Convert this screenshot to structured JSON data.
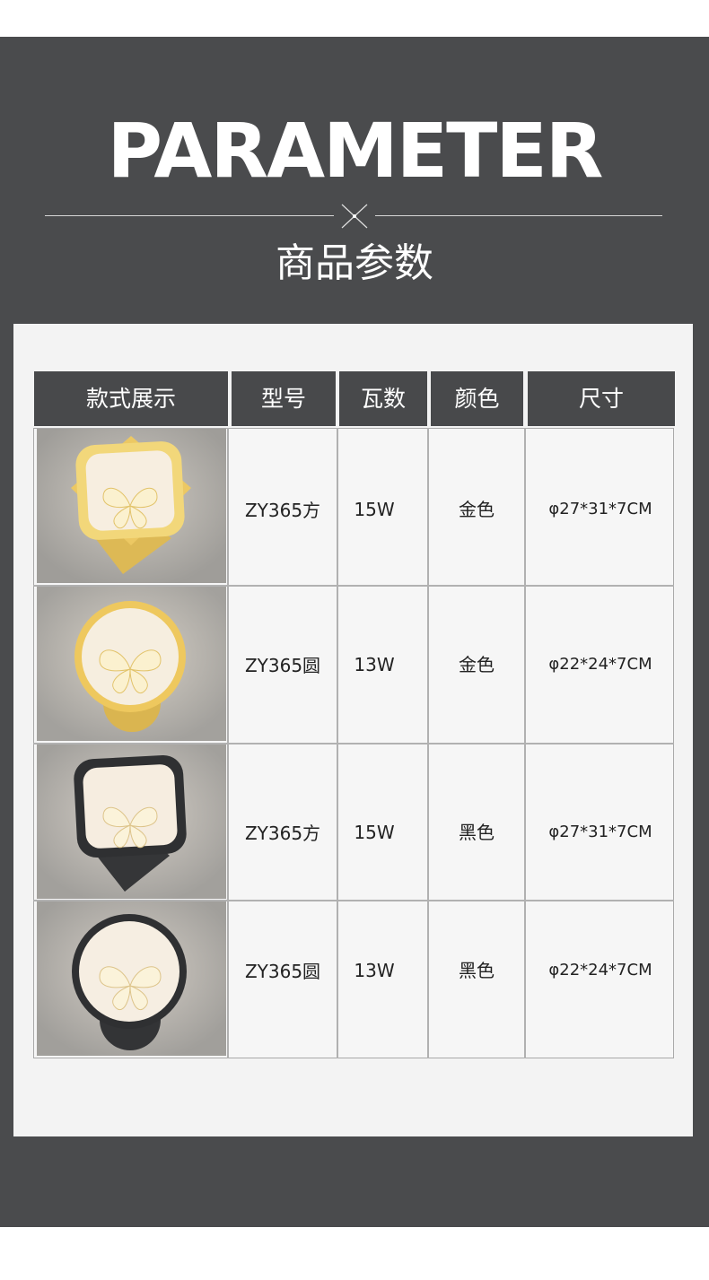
{
  "header": {
    "title_en": "PARAMETER",
    "title_cn": "商品参数"
  },
  "table": {
    "headers": [
      "款式展示",
      "型号",
      "瓦数",
      "颜色",
      "尺寸"
    ],
    "rows": [
      {
        "image": "gold-square-butterfly-lamp",
        "model": "ZY365方",
        "wattage": "15W",
        "color": "金色",
        "size": "φ27*31*7CM"
      },
      {
        "image": "gold-round-butterfly-lamp",
        "model": "ZY365圆",
        "wattage": "13W",
        "color": "金色",
        "size": "φ22*24*7CM"
      },
      {
        "image": "black-square-butterfly-lamp",
        "model": "ZY365方",
        "wattage": "15W",
        "color": "黑色",
        "size": "φ27*31*7CM"
      },
      {
        "image": "black-round-butterfly-lamp",
        "model": "ZY365圆",
        "wattage": "13W",
        "color": "黑色",
        "size": "φ22*24*7CM"
      }
    ]
  },
  "colors": {
    "panel": "#4a4b4d",
    "header_cell": "#48494b",
    "card": "#f3f3f3",
    "gold": "#e7c35a",
    "black": "#2f3032"
  }
}
